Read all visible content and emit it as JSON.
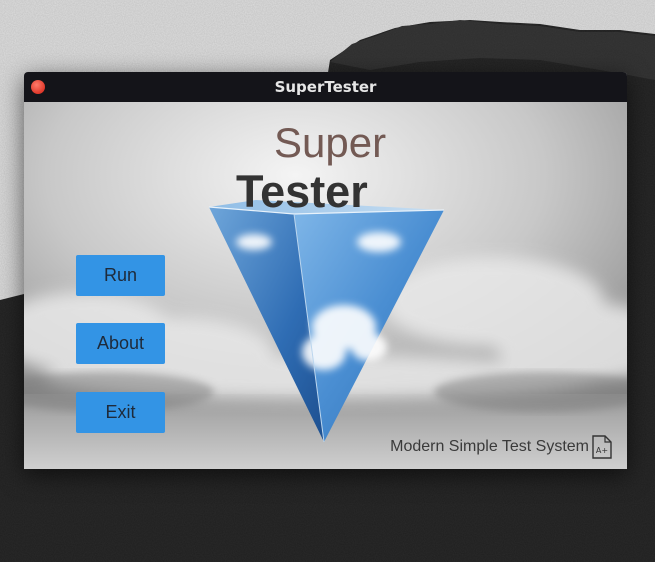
{
  "window": {
    "title": "SuperTester"
  },
  "hero": {
    "title_line1": "Super",
    "title_line2": "Tester"
  },
  "menu": {
    "run_label": "Run",
    "about_label": "About",
    "exit_label": "Exit"
  },
  "footer": {
    "tagline": "Modern Simple Test System",
    "icon_glyph": "A+"
  },
  "colors": {
    "accent": "#3394e5",
    "titlebar": "#141419",
    "close": "#e0382a",
    "super_text": "#735a54"
  },
  "icons": {
    "close": "close-dot-icon",
    "document": "document-grade-icon"
  }
}
